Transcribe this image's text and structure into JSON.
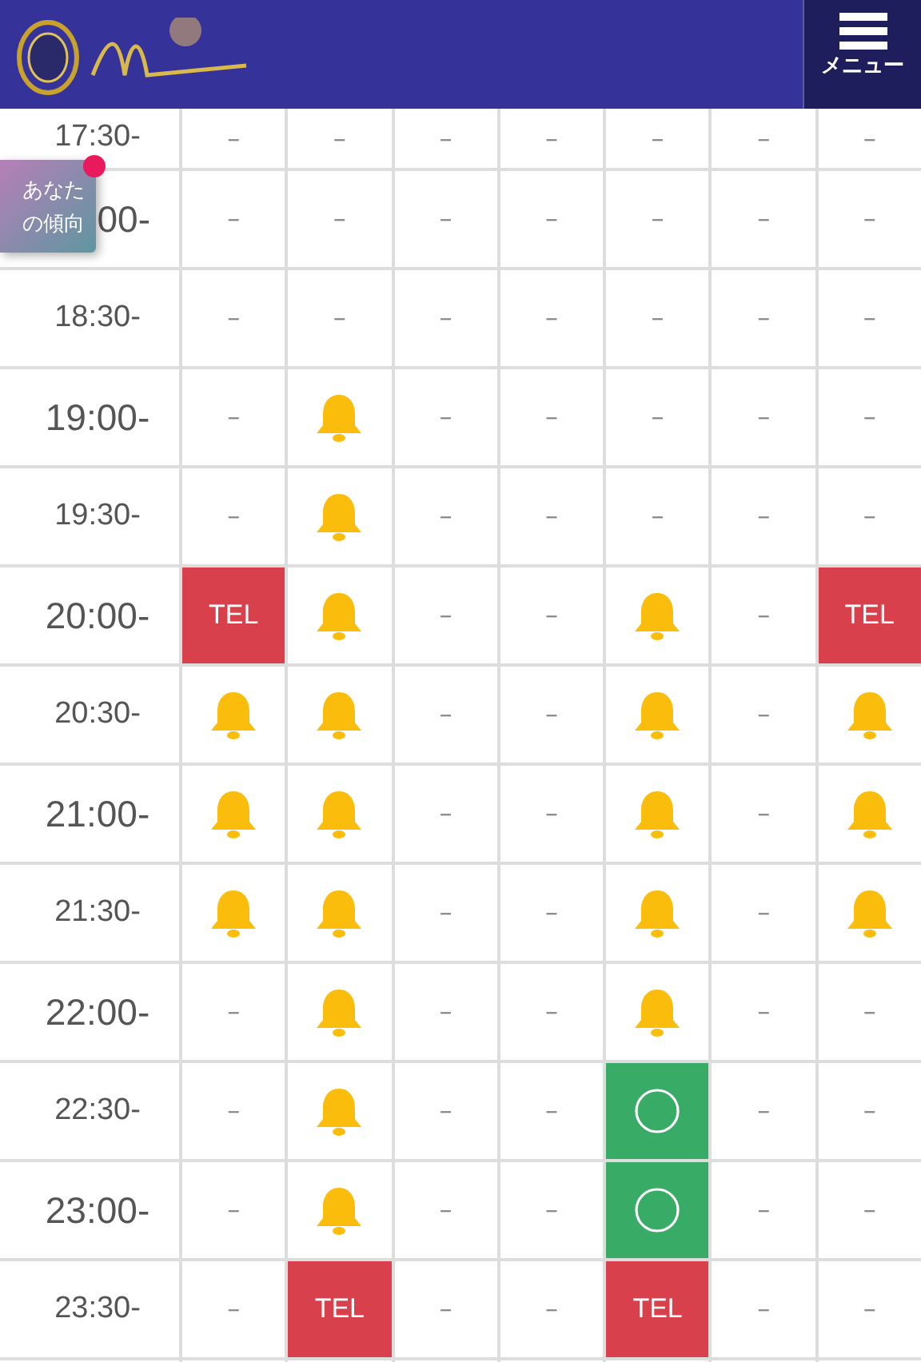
{
  "header": {
    "menu_label": "メニュー"
  },
  "floating_badge": {
    "label": "あなたの傾向",
    "notification": true
  },
  "schedule": [
    {
      "time": "17:30-",
      "cells": [
        {
          "kind": "dash",
          "text": "–"
        },
        {
          "kind": "dash",
          "text": "–"
        },
        {
          "kind": "dash",
          "text": "–"
        },
        {
          "kind": "dash",
          "text": "–"
        },
        {
          "kind": "dash",
          "text": "–"
        },
        {
          "kind": "dash",
          "text": "–"
        },
        {
          "kind": "dash",
          "text": "–"
        }
      ]
    },
    {
      "time": "00-",
      "cells": [
        {
          "kind": "dash",
          "text": "–"
        },
        {
          "kind": "dash",
          "text": "–"
        },
        {
          "kind": "dash",
          "text": "–"
        },
        {
          "kind": "dash",
          "text": "–"
        },
        {
          "kind": "dash",
          "text": "–"
        },
        {
          "kind": "dash",
          "text": "–"
        },
        {
          "kind": "dash",
          "text": "–"
        }
      ]
    },
    {
      "time": "18:30-",
      "cells": [
        {
          "kind": "dash",
          "text": "–"
        },
        {
          "kind": "dash",
          "text": "–"
        },
        {
          "kind": "dash",
          "text": "–"
        },
        {
          "kind": "dash",
          "text": "–"
        },
        {
          "kind": "dash",
          "text": "–"
        },
        {
          "kind": "dash",
          "text": "–"
        },
        {
          "kind": "dash",
          "text": "–"
        }
      ]
    },
    {
      "time": "19:00-",
      "cells": [
        {
          "kind": "dash",
          "text": "–"
        },
        {
          "kind": "bell"
        },
        {
          "kind": "dash",
          "text": "–"
        },
        {
          "kind": "dash",
          "text": "–"
        },
        {
          "kind": "dash",
          "text": "–"
        },
        {
          "kind": "dash",
          "text": "–"
        },
        {
          "kind": "dash",
          "text": "–"
        }
      ]
    },
    {
      "time": "19:30-",
      "cells": [
        {
          "kind": "dash",
          "text": "–"
        },
        {
          "kind": "bell"
        },
        {
          "kind": "dash",
          "text": "–"
        },
        {
          "kind": "dash",
          "text": "–"
        },
        {
          "kind": "dash",
          "text": "–"
        },
        {
          "kind": "dash",
          "text": "–"
        },
        {
          "kind": "dash",
          "text": "–"
        }
      ]
    },
    {
      "time": "20:00-",
      "cells": [
        {
          "kind": "tel",
          "text": "TEL"
        },
        {
          "kind": "bell"
        },
        {
          "kind": "dash",
          "text": "–"
        },
        {
          "kind": "dash",
          "text": "–"
        },
        {
          "kind": "bell"
        },
        {
          "kind": "dash",
          "text": "–"
        },
        {
          "kind": "tel",
          "text": "TEL"
        }
      ]
    },
    {
      "time": "20:30-",
      "cells": [
        {
          "kind": "bell"
        },
        {
          "kind": "bell"
        },
        {
          "kind": "dash",
          "text": "–"
        },
        {
          "kind": "dash",
          "text": "–"
        },
        {
          "kind": "bell"
        },
        {
          "kind": "dash",
          "text": "–"
        },
        {
          "kind": "bell"
        }
      ]
    },
    {
      "time": "21:00-",
      "cells": [
        {
          "kind": "bell"
        },
        {
          "kind": "bell"
        },
        {
          "kind": "dash",
          "text": "–"
        },
        {
          "kind": "dash",
          "text": "–"
        },
        {
          "kind": "bell"
        },
        {
          "kind": "dash",
          "text": "–"
        },
        {
          "kind": "bell"
        }
      ]
    },
    {
      "time": "21:30-",
      "cells": [
        {
          "kind": "bell"
        },
        {
          "kind": "bell"
        },
        {
          "kind": "dash",
          "text": "–"
        },
        {
          "kind": "dash",
          "text": "–"
        },
        {
          "kind": "bell"
        },
        {
          "kind": "dash",
          "text": "–"
        },
        {
          "kind": "bell"
        }
      ]
    },
    {
      "time": "22:00-",
      "cells": [
        {
          "kind": "dash",
          "text": "–"
        },
        {
          "kind": "bell"
        },
        {
          "kind": "dash",
          "text": "–"
        },
        {
          "kind": "dash",
          "text": "–"
        },
        {
          "kind": "bell"
        },
        {
          "kind": "dash",
          "text": "–"
        },
        {
          "kind": "dash",
          "text": "–"
        }
      ]
    },
    {
      "time": "22:30-",
      "cells": [
        {
          "kind": "dash",
          "text": "–"
        },
        {
          "kind": "bell"
        },
        {
          "kind": "dash",
          "text": "–"
        },
        {
          "kind": "dash",
          "text": "–"
        },
        {
          "kind": "circle"
        },
        {
          "kind": "dash",
          "text": "–"
        },
        {
          "kind": "dash",
          "text": "–"
        }
      ]
    },
    {
      "time": "23:00-",
      "cells": [
        {
          "kind": "dash",
          "text": "–"
        },
        {
          "kind": "bell"
        },
        {
          "kind": "dash",
          "text": "–"
        },
        {
          "kind": "dash",
          "text": "–"
        },
        {
          "kind": "circle"
        },
        {
          "kind": "dash",
          "text": "–"
        },
        {
          "kind": "dash",
          "text": "–"
        }
      ]
    },
    {
      "time": "23:30-",
      "cells": [
        {
          "kind": "dash",
          "text": "–"
        },
        {
          "kind": "tel",
          "text": "TEL"
        },
        {
          "kind": "dash",
          "text": "–"
        },
        {
          "kind": "dash",
          "text": "–"
        },
        {
          "kind": "tel",
          "text": "TEL"
        },
        {
          "kind": "dash",
          "text": "–"
        },
        {
          "kind": "dash",
          "text": "–"
        }
      ]
    }
  ]
}
